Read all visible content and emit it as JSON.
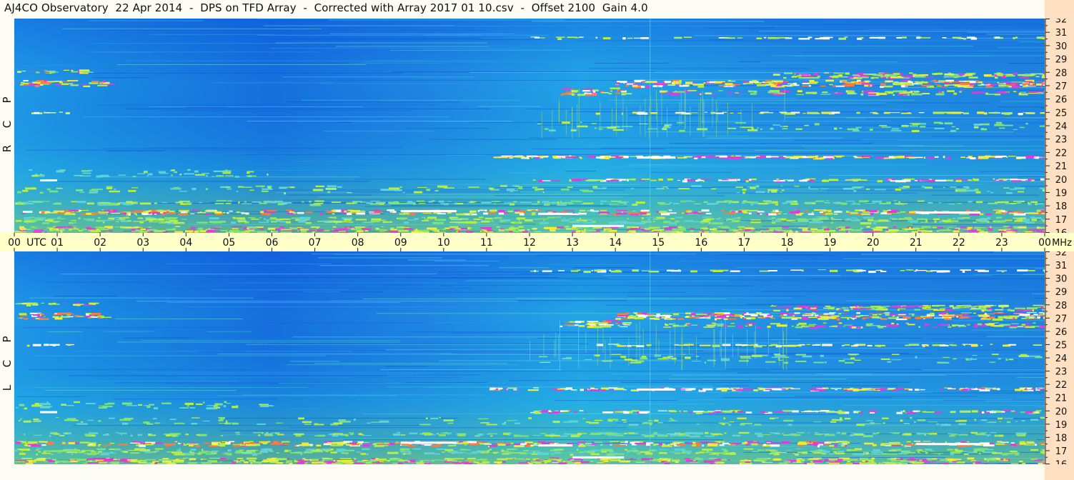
{
  "title": "AJ4CO Observatory  22 Apr 2014  -  DPS on TFD Array  -  Corrected with Array 2017 01 10.csv  -  Offset 2100  Gain 4.0",
  "panels": [
    {
      "id": "rcp",
      "label": "R  C  P"
    },
    {
      "id": "lcp",
      "label": "L  C  P"
    }
  ],
  "time_axis": {
    "ticks": [
      "00",
      "01",
      "02",
      "03",
      "04",
      "05",
      "06",
      "07",
      "08",
      "09",
      "10",
      "11",
      "12",
      "13",
      "14",
      "15",
      "16",
      "17",
      "18",
      "19",
      "20",
      "21",
      "22",
      "23",
      "00"
    ],
    "start_unit": "UTC",
    "end_unit": "MHz"
  },
  "freq_axis": {
    "ticks": [
      "32",
      "31",
      "30",
      "29",
      "28",
      "27",
      "26",
      "25",
      "24",
      "23",
      "22",
      "21",
      "20",
      "19",
      "18",
      "17",
      "16"
    ]
  },
  "chart_data": {
    "type": "heatmap",
    "title": "AJ4CO Observatory  22 Apr 2014  -  DPS on TFD Array  -  Corrected with Array 2017 01 10.csv  -  Offset 2100  Gain 4.0",
    "xlabel": "UTC",
    "ylabel": "MHz",
    "xlim": [
      0,
      24
    ],
    "ylim": [
      16,
      32
    ],
    "series": [
      {
        "name": "R C P"
      },
      {
        "name": "L C P"
      }
    ],
    "colors": {
      "background_low": "#0f5fe0",
      "mid": "#22b0e6",
      "high": "#b8ee4a",
      "peak_yellow": "#f0ee3a",
      "peak_magenta": "#e43bd6",
      "saturated": "#ffffff"
    }
  }
}
